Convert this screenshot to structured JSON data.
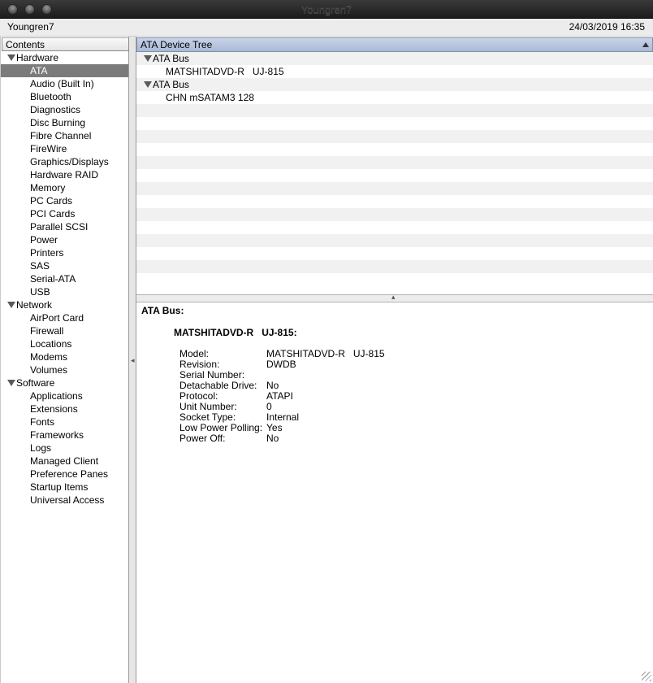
{
  "window": {
    "title": "Youngren7"
  },
  "header": {
    "machine_name": "Youngren7",
    "datetime": "24/03/2019 16:35"
  },
  "sidebar": {
    "header": "Contents",
    "items": [
      {
        "label": "Hardware",
        "type": "group"
      },
      {
        "label": "ATA",
        "type": "leaf",
        "selected": true
      },
      {
        "label": "Audio (Built In)",
        "type": "leaf"
      },
      {
        "label": "Bluetooth",
        "type": "leaf"
      },
      {
        "label": "Diagnostics",
        "type": "leaf"
      },
      {
        "label": "Disc Burning",
        "type": "leaf"
      },
      {
        "label": "Fibre Channel",
        "type": "leaf"
      },
      {
        "label": "FireWire",
        "type": "leaf"
      },
      {
        "label": "Graphics/Displays",
        "type": "leaf"
      },
      {
        "label": "Hardware RAID",
        "type": "leaf"
      },
      {
        "label": "Memory",
        "type": "leaf"
      },
      {
        "label": "PC Cards",
        "type": "leaf"
      },
      {
        "label": "PCI Cards",
        "type": "leaf"
      },
      {
        "label": "Parallel SCSI",
        "type": "leaf"
      },
      {
        "label": "Power",
        "type": "leaf"
      },
      {
        "label": "Printers",
        "type": "leaf"
      },
      {
        "label": "SAS",
        "type": "leaf"
      },
      {
        "label": "Serial-ATA",
        "type": "leaf"
      },
      {
        "label": "USB",
        "type": "leaf"
      },
      {
        "label": "Network",
        "type": "group"
      },
      {
        "label": "AirPort Card",
        "type": "leaf"
      },
      {
        "label": "Firewall",
        "type": "leaf"
      },
      {
        "label": "Locations",
        "type": "leaf"
      },
      {
        "label": "Modems",
        "type": "leaf"
      },
      {
        "label": "Volumes",
        "type": "leaf"
      },
      {
        "label": "Software",
        "type": "group"
      },
      {
        "label": "Applications",
        "type": "leaf"
      },
      {
        "label": "Extensions",
        "type": "leaf"
      },
      {
        "label": "Fonts",
        "type": "leaf"
      },
      {
        "label": "Frameworks",
        "type": "leaf"
      },
      {
        "label": "Logs",
        "type": "leaf"
      },
      {
        "label": "Managed Client",
        "type": "leaf"
      },
      {
        "label": "Preference Panes",
        "type": "leaf"
      },
      {
        "label": "Startup Items",
        "type": "leaf"
      },
      {
        "label": "Universal Access",
        "type": "leaf"
      }
    ]
  },
  "device_tree": {
    "header": "ATA Device Tree",
    "rows": [
      {
        "label": "ATA Bus",
        "type": "bus"
      },
      {
        "label": "MATSHITADVD-R   UJ-815",
        "type": "device"
      },
      {
        "label": "ATA Bus",
        "type": "bus"
      },
      {
        "label": "CHN mSATAM3 128",
        "type": "device"
      }
    ]
  },
  "details": {
    "bus_title": "ATA Bus:",
    "device_title": "MATSHITADVD-R   UJ-815:",
    "properties": [
      {
        "key": "Model:",
        "value": "MATSHITADVD-R   UJ-815"
      },
      {
        "key": "Revision:",
        "value": "DWDB"
      },
      {
        "key": "Serial Number:",
        "value": ""
      },
      {
        "key": "Detachable Drive:",
        "value": "No"
      },
      {
        "key": "Protocol:",
        "value": "ATAPI"
      },
      {
        "key": "Unit Number:",
        "value": "0"
      },
      {
        "key": "Socket Type:",
        "value": "Internal"
      },
      {
        "key": "Low Power Polling:",
        "value": "Yes"
      },
      {
        "key": "Power Off:",
        "value": "No"
      }
    ]
  }
}
